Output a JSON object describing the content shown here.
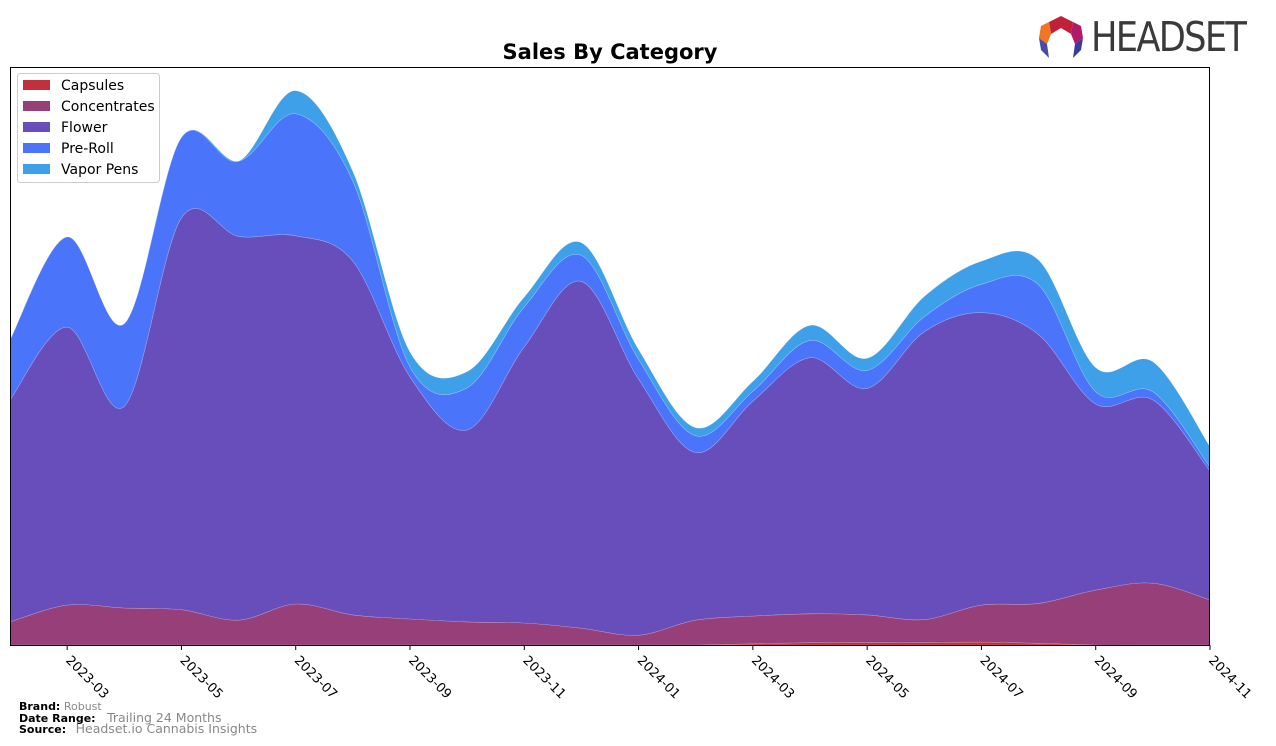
{
  "header": {
    "logo_text": "HEADSET",
    "logo_icon": "headset-logo-icon"
  },
  "footer": {
    "brand_label": "Brand:",
    "brand_value": "Robust",
    "date_range_label": "Date Range:",
    "date_range_value": "Trailing 24 Months",
    "source_label": "Source:",
    "source_value": "Headset.io Cannabis Insights"
  },
  "chart_data": {
    "type": "area",
    "stacked": true,
    "smooth": true,
    "title": "Sales By Category",
    "xlabel": "",
    "ylabel": "",
    "y_ticks_shown": false,
    "grid": false,
    "legend_position": "top-left",
    "x": [
      "2023-02",
      "2023-03",
      "2023-04",
      "2023-05",
      "2023-06",
      "2023-07",
      "2023-08",
      "2023-09",
      "2023-10",
      "2023-11",
      "2023-12",
      "2024-01",
      "2024-02",
      "2024-03",
      "2024-04",
      "2024-05",
      "2024-06",
      "2024-07",
      "2024-08",
      "2024-09",
      "2024-10",
      "2024-11"
    ],
    "x_tick_labels": [
      "2023-03",
      "2023-05",
      "2023-07",
      "2023-09",
      "2023-11",
      "2024-01",
      "2024-03",
      "2024-05",
      "2024-07",
      "2024-09",
      "2024-11"
    ],
    "ylim": [
      0,
      100
    ],
    "series": [
      {
        "name": "Capsules",
        "color": "#c0313d",
        "values": [
          0,
          0,
          0,
          0,
          0,
          0,
          0,
          0,
          0,
          0,
          0,
          0,
          0,
          0.2,
          0.4,
          0.4,
          0.4,
          0.5,
          0.3,
          0,
          0,
          0
        ]
      },
      {
        "name": "Concentrates",
        "color": "#973f78",
        "values": [
          4.0,
          6.9,
          6.4,
          6.1,
          4.3,
          7.1,
          5.2,
          4.5,
          4.0,
          3.8,
          2.9,
          1.7,
          4.3,
          4.8,
          5.0,
          4.8,
          4.0,
          6.4,
          6.9,
          9.5,
          10.7,
          7.8
        ]
      },
      {
        "name": "Flower",
        "color": "#684eba",
        "values": [
          38.4,
          48.1,
          34.9,
          67.8,
          66.4,
          63.7,
          61.2,
          41.9,
          33.2,
          47.8,
          60.0,
          44.3,
          29.0,
          37.2,
          44.3,
          39.2,
          49.8,
          50.6,
          46.5,
          32.2,
          31.7,
          22.3
        ]
      },
      {
        "name": "Pre-Roll",
        "color": "#4a74fa",
        "values": [
          10.4,
          15.6,
          14.3,
          13.9,
          13.0,
          21.1,
          13.8,
          1.7,
          7.3,
          6.9,
          4.5,
          3.4,
          2.9,
          1.7,
          3.0,
          3.1,
          2.6,
          4.9,
          8.6,
          2.1,
          1.4,
          0.7
        ]
      },
      {
        "name": "Vapor Pens",
        "color": "#3ea0e8",
        "values": [
          0,
          0,
          0,
          0,
          0,
          4.0,
          1.7,
          2.6,
          2.8,
          1.7,
          2.2,
          1.7,
          1.4,
          1.7,
          2.6,
          2.1,
          3.5,
          4.0,
          4.3,
          4.2,
          5.2,
          3.5
        ]
      }
    ]
  }
}
